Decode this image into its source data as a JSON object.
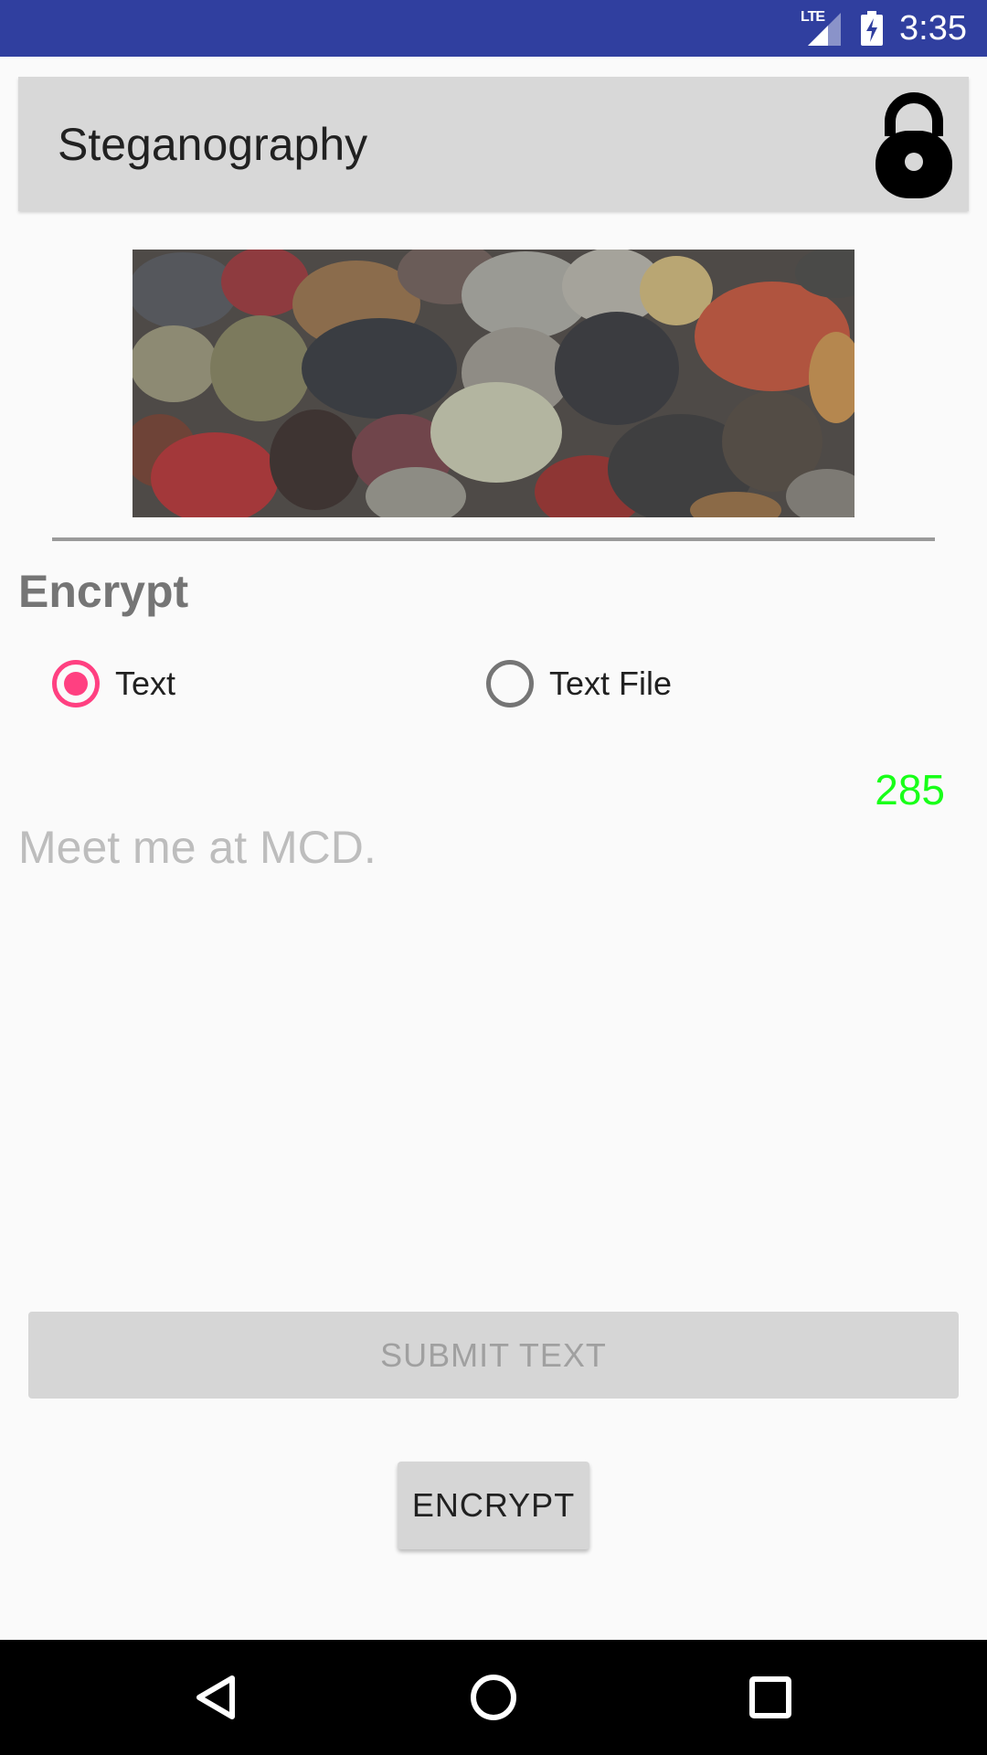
{
  "status_bar": {
    "network_label": "LTE",
    "time": "3:35",
    "icons": [
      "lte-signal-icon",
      "battery-charging-icon"
    ]
  },
  "header": {
    "title": "Steganography",
    "icon": "lock-icon"
  },
  "hero_image": {
    "description_icon": "pebbles-image"
  },
  "section": {
    "title": "Encrypt"
  },
  "mode_options": [
    {
      "label": "Text",
      "checked": true
    },
    {
      "label": "Text File",
      "checked": false
    }
  ],
  "char_counter": "285",
  "message_input": {
    "placeholder": "Meet me at MCD.",
    "value": ""
  },
  "buttons": {
    "submit_label": "SUBMIT TEXT",
    "encrypt_label": "ENCRYPT"
  },
  "nav_bar": {
    "icons": [
      "back-icon",
      "home-icon",
      "recents-icon"
    ]
  },
  "colors": {
    "status_bar": "#303f9f",
    "accent": "#ff4081",
    "counter": "#18ff18"
  }
}
